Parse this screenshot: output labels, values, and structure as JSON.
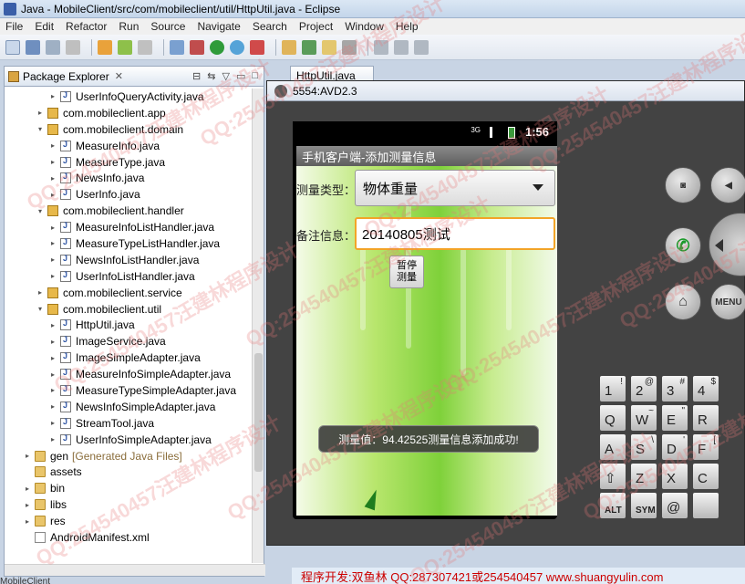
{
  "window": {
    "title": "Java - MobileClient/src/com/mobileclient/util/HttpUtil.java - Eclipse"
  },
  "menu": [
    "File",
    "Edit",
    "Refactor",
    "Run",
    "Source",
    "Navigate",
    "Search",
    "Project",
    "Window",
    "Help"
  ],
  "explorer": {
    "tab_title": "Package Explorer",
    "close": "✕",
    "tree": [
      {
        "label": "UserInfoQueryActivity.java",
        "type": "java",
        "indent": 3,
        "expand": "▸"
      },
      {
        "label": "com.mobileclient.app",
        "type": "pkg",
        "indent": 2,
        "expand": "▸"
      },
      {
        "label": "com.mobileclient.domain",
        "type": "pkg",
        "indent": 2,
        "expand": "▾"
      },
      {
        "label": "MeasureInfo.java",
        "type": "java",
        "indent": 3,
        "expand": "▸"
      },
      {
        "label": "MeasureType.java",
        "type": "java",
        "indent": 3,
        "expand": "▸"
      },
      {
        "label": "NewsInfo.java",
        "type": "java",
        "indent": 3,
        "expand": "▸"
      },
      {
        "label": "UserInfo.java",
        "type": "java",
        "indent": 3,
        "expand": "▸"
      },
      {
        "label": "com.mobileclient.handler",
        "type": "pkg",
        "indent": 2,
        "expand": "▾"
      },
      {
        "label": "MeasureInfoListHandler.java",
        "type": "java",
        "indent": 3,
        "expand": "▸"
      },
      {
        "label": "MeasureTypeListHandler.java",
        "type": "java",
        "indent": 3,
        "expand": "▸"
      },
      {
        "label": "NewsInfoListHandler.java",
        "type": "java",
        "indent": 3,
        "expand": "▸"
      },
      {
        "label": "UserInfoListHandler.java",
        "type": "java",
        "indent": 3,
        "expand": "▸"
      },
      {
        "label": "com.mobileclient.service",
        "type": "pkg",
        "indent": 2,
        "expand": "▸"
      },
      {
        "label": "com.mobileclient.util",
        "type": "pkg",
        "indent": 2,
        "expand": "▾"
      },
      {
        "label": "HttpUtil.java",
        "type": "java",
        "indent": 3,
        "expand": "▸"
      },
      {
        "label": "ImageService.java",
        "type": "java",
        "indent": 3,
        "expand": "▸"
      },
      {
        "label": "ImageSimpleAdapter.java",
        "type": "java",
        "indent": 3,
        "expand": "▸"
      },
      {
        "label": "MeasureInfoSimpleAdapter.java",
        "type": "java",
        "indent": 3,
        "expand": "▸"
      },
      {
        "label": "MeasureTypeSimpleAdapter.java",
        "type": "java",
        "indent": 3,
        "expand": "▸"
      },
      {
        "label": "NewsInfoSimpleAdapter.java",
        "type": "java",
        "indent": 3,
        "expand": "▸"
      },
      {
        "label": "StreamTool.java",
        "type": "java",
        "indent": 3,
        "expand": "▸"
      },
      {
        "label": "UserInfoSimpleAdapter.java",
        "type": "java",
        "indent": 3,
        "expand": "▸"
      },
      {
        "label": "gen",
        "extra": "[Generated Java Files]",
        "type": "folder",
        "indent": 1,
        "expand": "▸"
      },
      {
        "label": "assets",
        "type": "folder",
        "indent": 1,
        "expand": ""
      },
      {
        "label": "bin",
        "type": "folder",
        "indent": 1,
        "expand": "▸"
      },
      {
        "label": "libs",
        "type": "folder",
        "indent": 1,
        "expand": "▸"
      },
      {
        "label": "res",
        "type": "folder",
        "indent": 1,
        "expand": "▸"
      },
      {
        "label": "AndroidManifest.xml",
        "type": "xml",
        "indent": 1,
        "expand": ""
      }
    ]
  },
  "editor": {
    "tab": "HttpUtil.java"
  },
  "emulator": {
    "title": "5554:AVD2.3",
    "status": {
      "time": "1:56",
      "network": "3G"
    },
    "app_title": "手机客户端-添加测量信息",
    "type_label": "测量类型：",
    "type_value": "物体重量",
    "remark_label": "备注信息：",
    "remark_value": "20140805测试",
    "pause_button": [
      "暂停",
      "测量"
    ],
    "toast": "测量值：94.42525测量信息添加成功!",
    "hw": {
      "menu": "MENU"
    },
    "keys": [
      {
        "m": "1",
        "s": "!"
      },
      {
        "m": "2",
        "s": "@"
      },
      {
        "m": "3",
        "s": "#"
      },
      {
        "m": "4",
        "s": "$"
      },
      {
        "m": "Q",
        "s": ""
      },
      {
        "m": "W",
        "s": "~"
      },
      {
        "m": "E",
        "s": "\""
      },
      {
        "m": "R",
        "s": ""
      },
      {
        "m": "A",
        "s": ""
      },
      {
        "m": "S",
        "s": "\\"
      },
      {
        "m": "D",
        "s": "'"
      },
      {
        "m": "F",
        "s": "["
      },
      {
        "m": "⇧",
        "s": ""
      },
      {
        "m": "Z",
        "s": ""
      },
      {
        "m": "X",
        "s": ""
      },
      {
        "m": "C",
        "s": ""
      },
      {
        "m": "ALT",
        "s": ""
      },
      {
        "m": "SYM",
        "s": ""
      },
      {
        "m": "@",
        "s": ""
      },
      {
        "m": "",
        "s": ""
      }
    ]
  },
  "footer": {
    "credit": "程序开发:双鱼林 QQ:287307421或254540457 www.shuangyulin.com",
    "left": "MobileClient"
  },
  "watermark": "QQ:254540457汪建林程序设计",
  "colors": {
    "accent": "#f2a427",
    "toast_bg": "#3c3c3c",
    "green_bg": "#7fd13a",
    "footer_text": "#cc0000"
  }
}
